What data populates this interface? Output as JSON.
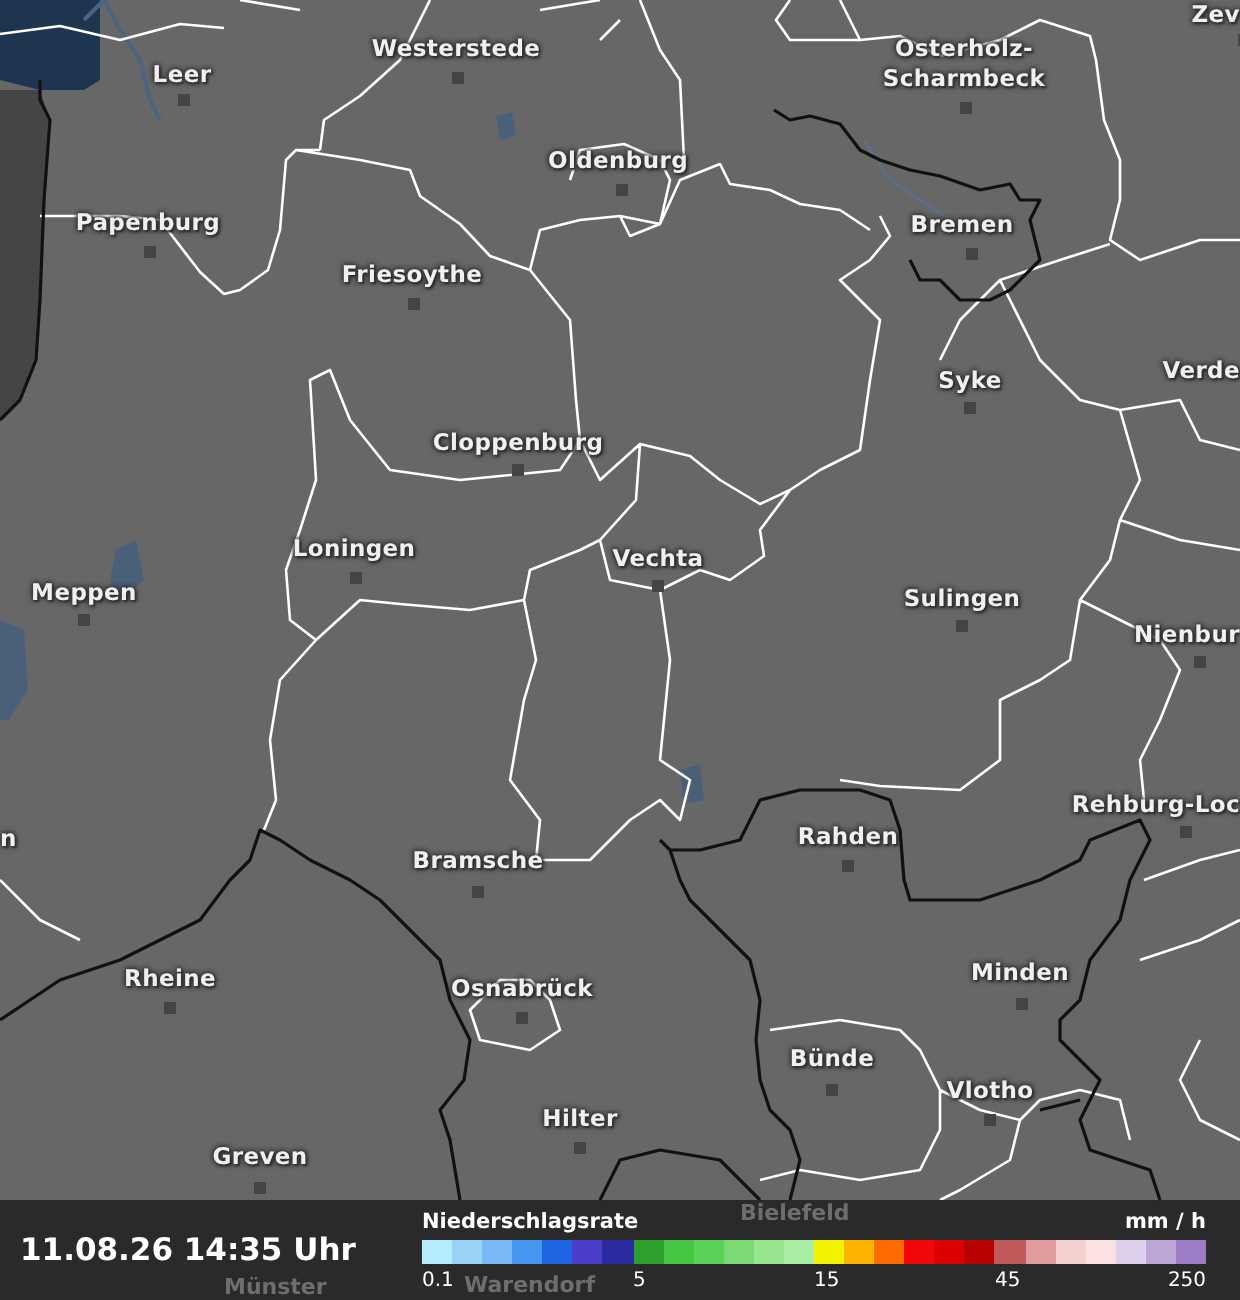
{
  "map": {
    "cities": [
      {
        "name": "Westerstede"
      },
      {
        "name": "Leer"
      },
      {
        "name": "Oldenburg"
      },
      {
        "name": "Osterholz-\nScharmbeck"
      },
      {
        "name": "Zev"
      },
      {
        "name": "Papenburg"
      },
      {
        "name": "Friesoythe"
      },
      {
        "name": "Bremen"
      },
      {
        "name": "Syke"
      },
      {
        "name": "Verde"
      },
      {
        "name": "Cloppenburg"
      },
      {
        "name": "Loningen"
      },
      {
        "name": "Vechta"
      },
      {
        "name": "Meppen"
      },
      {
        "name": "Sulingen"
      },
      {
        "name": "Nienbur"
      },
      {
        "name": "Rehburg-Loc"
      },
      {
        "name": "n"
      },
      {
        "name": "Rahden"
      },
      {
        "name": "Bramsche"
      },
      {
        "name": "Rheine"
      },
      {
        "name": "Minden"
      },
      {
        "name": "Osnabrück"
      },
      {
        "name": "Bünde"
      },
      {
        "name": "Vlotho"
      },
      {
        "name": "Hilter"
      },
      {
        "name": "Greven"
      }
    ]
  },
  "footer": {
    "timestamp": "11.08.26 14:35 Uhr",
    "faint_cities": [
      "Bielefeld",
      "Münster",
      "Warendorf"
    ],
    "legend": {
      "title": "Niederschlagsrate",
      "unit": "mm / h",
      "cells": [
        {
          "color": "#b4ecfd",
          "label": "0.1"
        },
        {
          "color": "#9ad3f8"
        },
        {
          "color": "#78b8f4"
        },
        {
          "color": "#4596ee"
        },
        {
          "color": "#2066e4"
        },
        {
          "color": "#4c3ec8"
        },
        {
          "color": "#2c2aa0"
        },
        {
          "color": "#2ea02c",
          "label": "5"
        },
        {
          "color": "#46c642"
        },
        {
          "color": "#5ad258"
        },
        {
          "color": "#7cda76"
        },
        {
          "color": "#98e690"
        },
        {
          "color": "#aaeea6"
        },
        {
          "color": "#f4f400",
          "label": "15"
        },
        {
          "color": "#ffb400"
        },
        {
          "color": "#ff6a00"
        },
        {
          "color": "#f20808"
        },
        {
          "color": "#dc0000"
        },
        {
          "color": "#b80000"
        },
        {
          "color": "#c05a5a",
          "label": "45"
        },
        {
          "color": "#e09c9c"
        },
        {
          "color": "#f4d0d0"
        },
        {
          "color": "#fce2e2"
        },
        {
          "color": "#dcd0ec"
        },
        {
          "color": "#bca6d6"
        },
        {
          "color": "#9c7cc4",
          "label": "250"
        }
      ]
    }
  }
}
